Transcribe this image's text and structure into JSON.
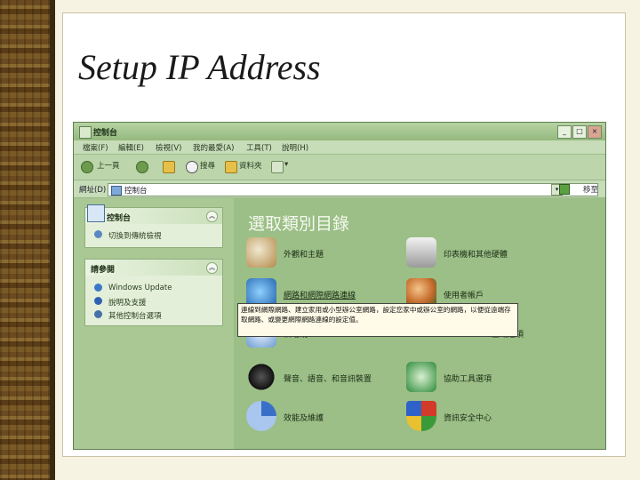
{
  "slide": {
    "title": "Setup IP Address"
  },
  "window": {
    "title": "控制台",
    "buttons": {
      "minimize": "_",
      "maximize": "□",
      "close": "×"
    },
    "menu": [
      "檔案(F)",
      "編輯(E)",
      "檢視(V)",
      "我的最愛(A)",
      "工具(T)",
      "說明(H)"
    ],
    "toolbar": {
      "back": "上一頁",
      "search": "搜尋",
      "folders": "資料夾",
      "views": "▾"
    },
    "address": {
      "label": "網址(D)",
      "value": "控制台",
      "go": "移至"
    }
  },
  "left_panel": {
    "control_panel_box": {
      "title": "控制台",
      "items": [
        "切換到傳統檢視"
      ]
    },
    "see_also_box": {
      "title": "請參閱",
      "items": [
        "Windows Update",
        "說明及支援",
        "其他控制台選項"
      ]
    }
  },
  "right_panel": {
    "heading": "選取類別目錄",
    "categories": [
      {
        "label": "外觀和主題",
        "icon": "appearance-icon"
      },
      {
        "label": "印表機和其他硬體",
        "icon": "printer-icon"
      },
      {
        "label": "網路和網際網路連線",
        "icon": "network-icon"
      },
      {
        "label": "使用者帳戶",
        "icon": "users-icon"
      },
      {
        "label": "新增或移除程式",
        "icon": "programs-icon"
      },
      {
        "label": "日期、時間、語言和區域選項",
        "icon": "regional-icon"
      },
      {
        "label": "聲音、語音、和音訊裝置",
        "icon": "sound-icon"
      },
      {
        "label": "協助工具選項",
        "icon": "accessibility-icon"
      },
      {
        "label": "效能及維護",
        "icon": "performance-icon"
      },
      {
        "label": "資訊安全中心",
        "icon": "security-center-icon"
      }
    ],
    "visible_labels": {
      "programs_short": "新增或",
      "regional_short": "區域選項"
    },
    "tooltip": "連線到網際網路、建立家用或小型辦公室網路，設定您家中或辦公室的網路，以便從遠端存取網路、或變更網際網路連線的設定值。"
  }
}
